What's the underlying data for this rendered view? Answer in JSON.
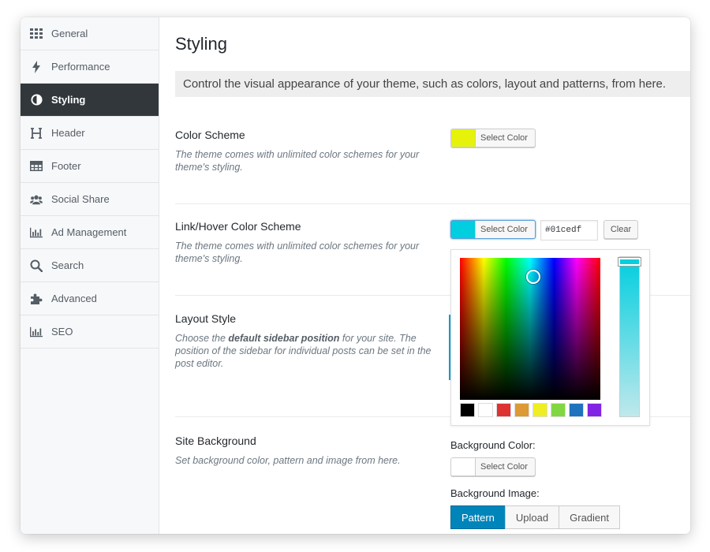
{
  "sidebar": {
    "items": [
      {
        "label": "General",
        "icon": "grid-icon"
      },
      {
        "label": "Performance",
        "icon": "bolt-icon"
      },
      {
        "label": "Styling",
        "icon": "half-circle-icon",
        "active": true
      },
      {
        "label": "Header",
        "icon": "h-icon"
      },
      {
        "label": "Footer",
        "icon": "table-icon"
      },
      {
        "label": "Social Share",
        "icon": "users-icon"
      },
      {
        "label": "Ad Management",
        "icon": "bar-chart-icon"
      },
      {
        "label": "Search",
        "icon": "search-icon"
      },
      {
        "label": "Advanced",
        "icon": "puzzle-icon"
      },
      {
        "label": "SEO",
        "icon": "bar-chart-icon"
      }
    ]
  },
  "main": {
    "title": "Styling",
    "intro": "Control the visual appearance of your theme, such as colors, layout and patterns, from here."
  },
  "sections": {
    "color_scheme": {
      "title": "Color Scheme",
      "desc": "The theme comes with unlimited color schemes for your theme's styling.",
      "button_label": "Select Color",
      "color": "#e6f20a"
    },
    "link_hover": {
      "title": "Link/Hover Color Scheme",
      "desc": "The theme comes with unlimited color schemes for your theme's styling.",
      "button_label": "Select Color",
      "color": "#01cedf",
      "hex_value": "#01cedf",
      "clear_label": "Clear"
    },
    "layout_style": {
      "title": "Layout Style",
      "desc_pre": "Choose the ",
      "desc_bold": "default sidebar position",
      "desc_post": " for your site. The position of the sidebar for individual posts can be set in the post editor."
    },
    "site_background": {
      "title": "Site Background",
      "desc": "Set background color, pattern and image from here.",
      "bg_color_label": "Background Color:",
      "button_label": "Select Color",
      "color": "#ffffff",
      "bg_image_label": "Background Image:",
      "tabs": [
        "Pattern",
        "Upload",
        "Gradient"
      ],
      "active_tab": "Pattern"
    }
  },
  "picker": {
    "palette": [
      "#000000",
      "#ffffff",
      "#dd3333",
      "#dd9933",
      "#eeee22",
      "#81d742",
      "#1e73be",
      "#8224e3"
    ]
  }
}
